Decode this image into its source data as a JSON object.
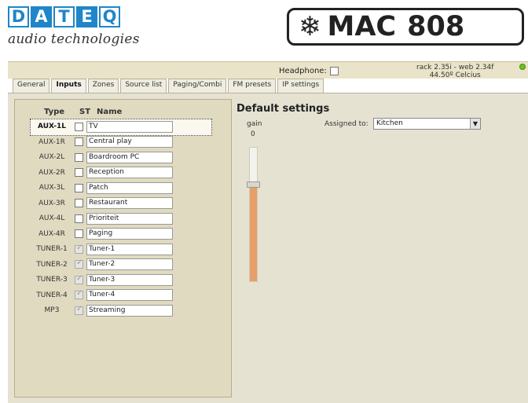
{
  "brand": {
    "letters": [
      "D",
      "A",
      "T",
      "E",
      "Q"
    ],
    "tagline": "audio technologies",
    "product": "MAC",
    "model": "808",
    "accent": "#1f86c9"
  },
  "status": {
    "headphone_label": "Headphone:",
    "version_line1": "rack 2.35i - web 2.34f",
    "version_line2": "44.50º Celcius",
    "led_color": "#6ec21a"
  },
  "tabs": [
    {
      "label": "General",
      "active": false
    },
    {
      "label": "Inputs",
      "active": true
    },
    {
      "label": "Zones",
      "active": false
    },
    {
      "label": "Source list",
      "active": false
    },
    {
      "label": "Paging/Combi",
      "active": false
    },
    {
      "label": "FM presets",
      "active": false
    },
    {
      "label": "IP settings",
      "active": false
    }
  ],
  "inputs_table": {
    "headers": {
      "type": "Type",
      "st": "ST",
      "name": "Name"
    },
    "rows": [
      {
        "type": "AUX-1L",
        "st_checked": false,
        "st_disabled": false,
        "name": "TV",
        "selected": true
      },
      {
        "type": "AUX-1R",
        "st_checked": false,
        "st_disabled": false,
        "name": "Central play",
        "selected": false
      },
      {
        "type": "AUX-2L",
        "st_checked": false,
        "st_disabled": false,
        "name": "Boardroom PC",
        "selected": false
      },
      {
        "type": "AUX-2R",
        "st_checked": false,
        "st_disabled": false,
        "name": "Reception",
        "selected": false
      },
      {
        "type": "AUX-3L",
        "st_checked": false,
        "st_disabled": false,
        "name": "Patch",
        "selected": false
      },
      {
        "type": "AUX-3R",
        "st_checked": false,
        "st_disabled": false,
        "name": "Restaurant",
        "selected": false
      },
      {
        "type": "AUX-4L",
        "st_checked": false,
        "st_disabled": false,
        "name": "Prioriteit",
        "selected": false
      },
      {
        "type": "AUX-4R",
        "st_checked": false,
        "st_disabled": false,
        "name": "Paging",
        "selected": false
      },
      {
        "type": "TUNER-1",
        "st_checked": true,
        "st_disabled": true,
        "name": "Tuner-1",
        "selected": false
      },
      {
        "type": "TUNER-2",
        "st_checked": true,
        "st_disabled": true,
        "name": "Tuner-2",
        "selected": false
      },
      {
        "type": "TUNER-3",
        "st_checked": true,
        "st_disabled": true,
        "name": "Tuner-3",
        "selected": false
      },
      {
        "type": "TUNER-4",
        "st_checked": true,
        "st_disabled": true,
        "name": "Tuner-4",
        "selected": false
      },
      {
        "type": "MP3",
        "st_checked": true,
        "st_disabled": true,
        "name": "Streaming",
        "selected": false
      }
    ]
  },
  "default_settings": {
    "title": "Default settings",
    "gain_label": "gain",
    "gain_value": "0",
    "gain_level_fraction": 0.72,
    "assigned_label": "Assigned to:",
    "assigned_value": "Kitchen"
  }
}
